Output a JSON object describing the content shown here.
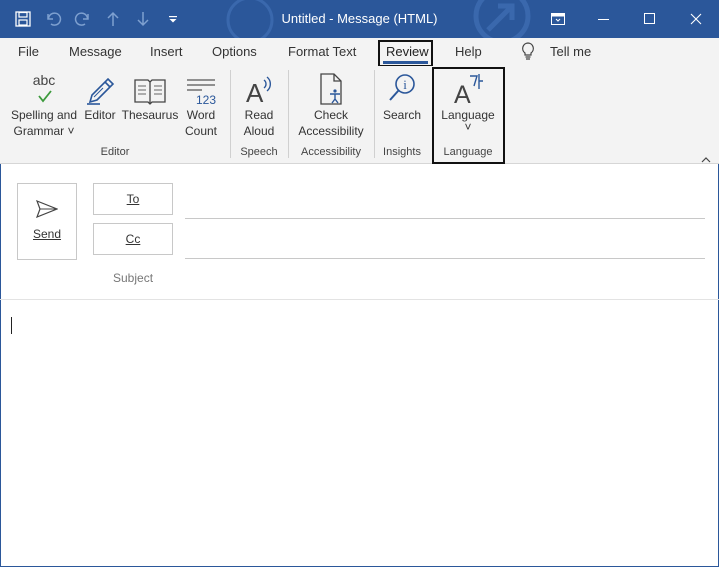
{
  "window": {
    "title": "Untitled  -  Message (HTML)",
    "accent_color": "#2b579a"
  },
  "qat_icons": [
    "save-icon",
    "undo-icon",
    "redo-icon",
    "up-arrow-icon",
    "down-arrow-icon",
    "customize-qat-icon"
  ],
  "window_controls": [
    "ribbon-display-options-icon",
    "minimize-icon",
    "maximize-icon",
    "close-icon"
  ],
  "tabs": [
    {
      "label": "File"
    },
    {
      "label": "Message"
    },
    {
      "label": "Insert"
    },
    {
      "label": "Options"
    },
    {
      "label": "Format Text"
    },
    {
      "label": "Review"
    },
    {
      "label": "Help"
    },
    {
      "label": "Tell me"
    }
  ],
  "active_tab": "Review",
  "ribbon": {
    "spelling": {
      "label1": "Spelling and",
      "label2": "Grammar ˅",
      "icon_text": "abc"
    },
    "editor": {
      "label": "Editor"
    },
    "thesaurus": {
      "label": "Thesaurus"
    },
    "word_count": {
      "label1": "Word",
      "label2": "Count",
      "icon_text": "123"
    },
    "read_aloud": {
      "label1": "Read",
      "label2": "Aloud"
    },
    "check_accessibility": {
      "label1": "Check",
      "label2": "Accessibility"
    },
    "search": {
      "label": "Search"
    },
    "language": {
      "label": "Language",
      "chevron": "˅"
    },
    "groups": {
      "editor": "Editor",
      "speech": "Speech",
      "accessibility": "Accessibility",
      "insights": "Insights",
      "language": "Language"
    }
  },
  "compose": {
    "send": "Send",
    "to": "To",
    "cc": "Cc",
    "subject": "Subject"
  }
}
